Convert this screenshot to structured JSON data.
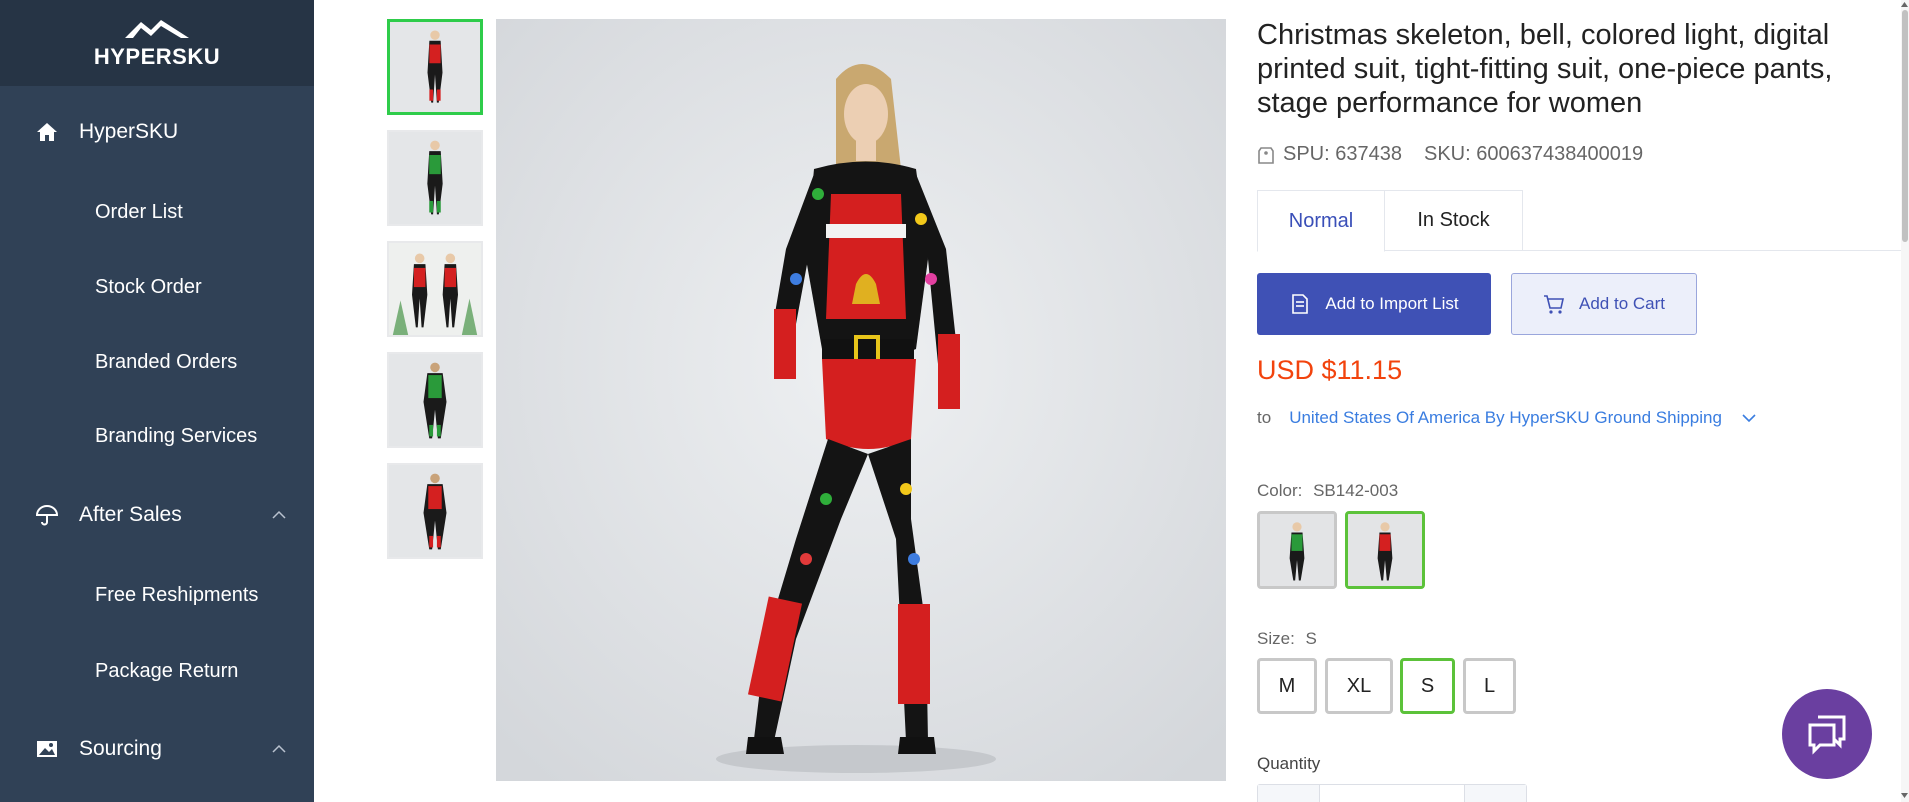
{
  "brand": {
    "name": "HYPERSKU"
  },
  "sidebar": {
    "home": {
      "label": "HyperSKU",
      "icon": "home-icon"
    },
    "items_top": [
      {
        "label": "Order List"
      },
      {
        "label": "Stock Order"
      },
      {
        "label": "Branded Orders"
      },
      {
        "label": "Branding Services"
      }
    ],
    "after_sales": {
      "label": "After Sales",
      "icon": "umbrella-icon",
      "state": "expanded"
    },
    "items_after_sales": [
      {
        "label": "Free Reshipments"
      },
      {
        "label": "Package Return"
      }
    ],
    "sourcing": {
      "label": "Sourcing",
      "icon": "image-icon",
      "state": "expanded"
    },
    "colors": {
      "background": "#304156",
      "logo_background": "#263445",
      "text": "#ffffff"
    }
  },
  "gallery": {
    "thumbnails": [
      {
        "variant": "red-black",
        "selected": true
      },
      {
        "variant": "green-black",
        "selected": false
      },
      {
        "variant": "duo-red",
        "selected": false
      },
      {
        "variant": "green-back",
        "selected": false
      },
      {
        "variant": "red-back",
        "selected": false
      }
    ],
    "selected_border": "#2ecc4a"
  },
  "product": {
    "title": "Christmas skeleton, bell, colored light, digital printed suit, tight-fitting suit, one-piece pants, stage performance for women",
    "spu": "SPU: 637438",
    "sku": "SKU: 600637438400019",
    "tabs": [
      {
        "label": "Normal",
        "active": true
      },
      {
        "label": "In Stock",
        "active": false
      }
    ],
    "buttons": {
      "import": "Add to Import List",
      "cart": "Add to Cart"
    },
    "price": "USD $11.15",
    "shipping": {
      "to_label": "to",
      "destination": "United States Of America By HyperSKU Ground Shipping"
    },
    "color": {
      "label": "Color:",
      "value": "SB142-003",
      "options": [
        {
          "variant": "green-black",
          "selected": false
        },
        {
          "variant": "red-black",
          "selected": true
        }
      ]
    },
    "size": {
      "label": "Size:",
      "value": "S",
      "options": [
        {
          "label": "M",
          "selected": false
        },
        {
          "label": "XL",
          "selected": false
        },
        {
          "label": "S",
          "selected": true
        },
        {
          "label": "L",
          "selected": false
        }
      ]
    },
    "quantity": {
      "label": "Quantity"
    }
  },
  "colors": {
    "primary": "#3f51b5",
    "price": "#f2430d",
    "link": "#3a7de0",
    "selected_option": "#5cc23a",
    "chat": "#6a3fa0"
  },
  "chat": {
    "icon": "chat-bubbles-icon"
  }
}
